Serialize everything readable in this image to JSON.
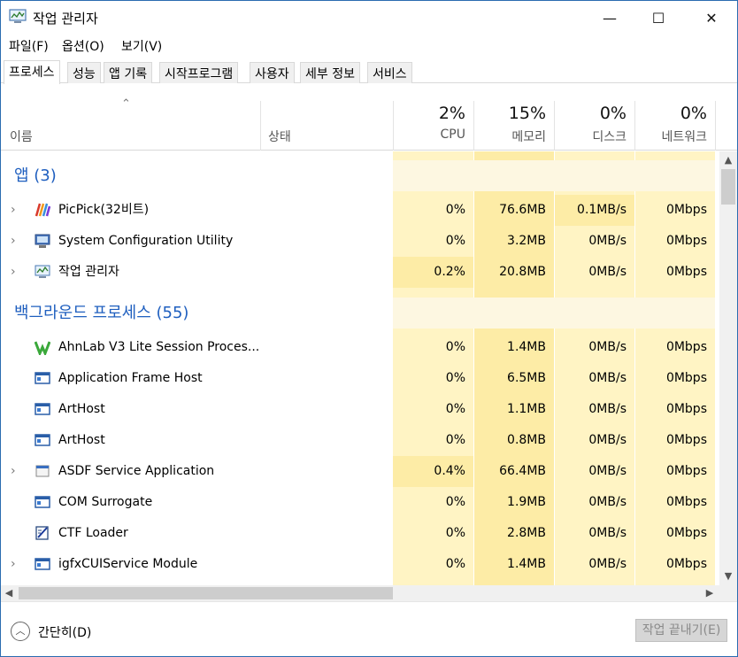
{
  "window": {
    "title": "작업 관리자",
    "controls": {
      "minimize": "—",
      "maximize": "☐",
      "close": "✕"
    }
  },
  "menu": [
    "파일(F)",
    "옵션(O)",
    "보기(V)"
  ],
  "tabs": [
    "프로세스",
    "성능",
    "앱 기록",
    "시작프로그램",
    "사용자",
    "세부 정보",
    "서비스"
  ],
  "columns": {
    "name": "이름",
    "status": "상태",
    "cpu": {
      "pct": "2%",
      "label": "CPU"
    },
    "memory": {
      "pct": "15%",
      "label": "메모리"
    },
    "disk": {
      "pct": "0%",
      "label": "디스크"
    },
    "network": {
      "pct": "0%",
      "label": "네트워크"
    }
  },
  "groups": {
    "apps": "앱 (3)",
    "background": "백그라운드 프로세스 (55)"
  },
  "rows": [
    {
      "name": "PicPick(32비트)",
      "cpu": "0%",
      "memory": "76.6MB",
      "disk": "0.1MB/s",
      "network": "0Mbps"
    },
    {
      "name": "System Configuration Utility",
      "cpu": "0%",
      "memory": "3.2MB",
      "disk": "0MB/s",
      "network": "0Mbps"
    },
    {
      "name": "작업 관리자",
      "cpu": "0.2%",
      "memory": "20.8MB",
      "disk": "0MB/s",
      "network": "0Mbps"
    },
    {
      "name": "AhnLab V3 Lite Session Proces...",
      "cpu": "0%",
      "memory": "1.4MB",
      "disk": "0MB/s",
      "network": "0Mbps"
    },
    {
      "name": "Application Frame Host",
      "cpu": "0%",
      "memory": "6.5MB",
      "disk": "0MB/s",
      "network": "0Mbps"
    },
    {
      "name": "ArtHost",
      "cpu": "0%",
      "memory": "1.1MB",
      "disk": "0MB/s",
      "network": "0Mbps"
    },
    {
      "name": "ArtHost",
      "cpu": "0%",
      "memory": "0.8MB",
      "disk": "0MB/s",
      "network": "0Mbps"
    },
    {
      "name": "ASDF Service Application",
      "cpu": "0.4%",
      "memory": "66.4MB",
      "disk": "0MB/s",
      "network": "0Mbps"
    },
    {
      "name": "COM Surrogate",
      "cpu": "0%",
      "memory": "1.9MB",
      "disk": "0MB/s",
      "network": "0Mbps"
    },
    {
      "name": "CTF Loader",
      "cpu": "0%",
      "memory": "2.8MB",
      "disk": "0MB/s",
      "network": "0Mbps"
    },
    {
      "name": "igfxCUIService Module",
      "cpu": "0%",
      "memory": "1.4MB",
      "disk": "0MB/s",
      "network": "0Mbps"
    }
  ],
  "footer": {
    "fewer_details": "간단히(D)",
    "end_task": "작업 끝내기(E)"
  },
  "colors": {
    "accent": "#1f5fbf",
    "heat_light": "#fff4c4",
    "heat_mid": "#fdeca6",
    "heat_group": "#fdf7e1"
  }
}
